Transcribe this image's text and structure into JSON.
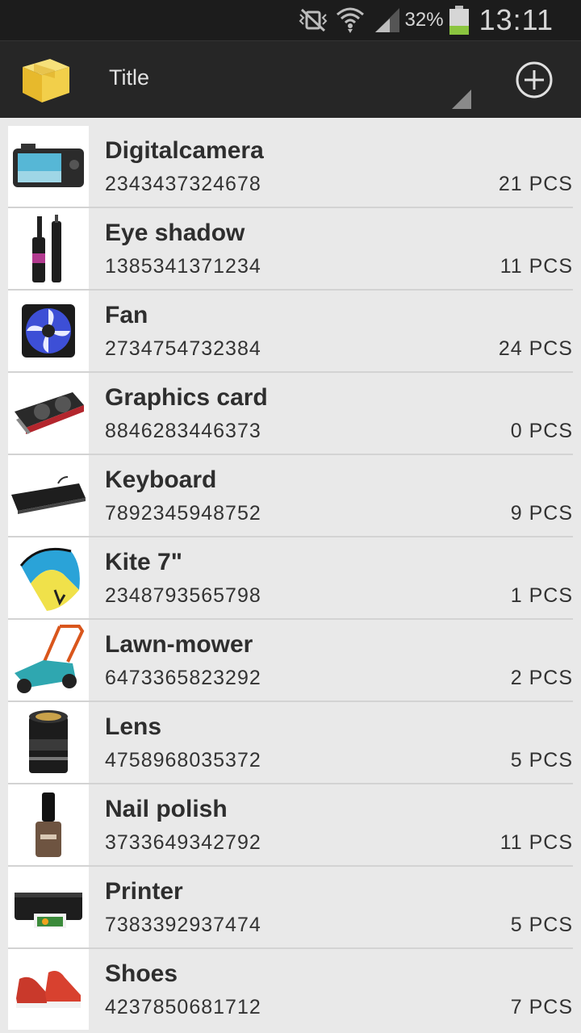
{
  "status_bar": {
    "battery_percent": "32%",
    "time": "13:11",
    "icons": [
      "vibrate-mute-icon",
      "wifi-icon",
      "signal-icon",
      "battery-icon"
    ],
    "battery_color": "#8bc53f"
  },
  "action_bar": {
    "title": "Title",
    "logo_icon": "package-box-icon",
    "add_icon": "add-circle-icon"
  },
  "items": [
    {
      "name": "Digitalcamera",
      "code": "2343437324678",
      "qty": "21 PCS",
      "icon": "camera-icon"
    },
    {
      "name": "Eye shadow",
      "code": "1385341371234",
      "qty": "11 PCS",
      "icon": "mascara-icon"
    },
    {
      "name": "Fan",
      "code": "2734754732384",
      "qty": "24 PCS",
      "icon": "fan-icon"
    },
    {
      "name": "Graphics card",
      "code": "8846283446373",
      "qty": "0 PCS",
      "icon": "graphics-card-icon"
    },
    {
      "name": "Keyboard",
      "code": "7892345948752",
      "qty": "9 PCS",
      "icon": "keyboard-icon"
    },
    {
      "name": "Kite 7\"",
      "code": "2348793565798",
      "qty": "1 PCS",
      "icon": "kite-icon"
    },
    {
      "name": "Lawn-mower",
      "code": "6473365823292",
      "qty": "2 PCS",
      "icon": "lawn-mower-icon"
    },
    {
      "name": "Lens",
      "code": "4758968035372",
      "qty": "5 PCS",
      "icon": "lens-icon"
    },
    {
      "name": "Nail polish",
      "code": "3733649342792",
      "qty": "11 PCS",
      "icon": "nail-polish-icon"
    },
    {
      "name": "Printer",
      "code": "7383392937474",
      "qty": "5 PCS",
      "icon": "printer-icon"
    },
    {
      "name": "Shoes",
      "code": "4237850681712",
      "qty": "7 PCS",
      "icon": "shoes-icon"
    }
  ]
}
